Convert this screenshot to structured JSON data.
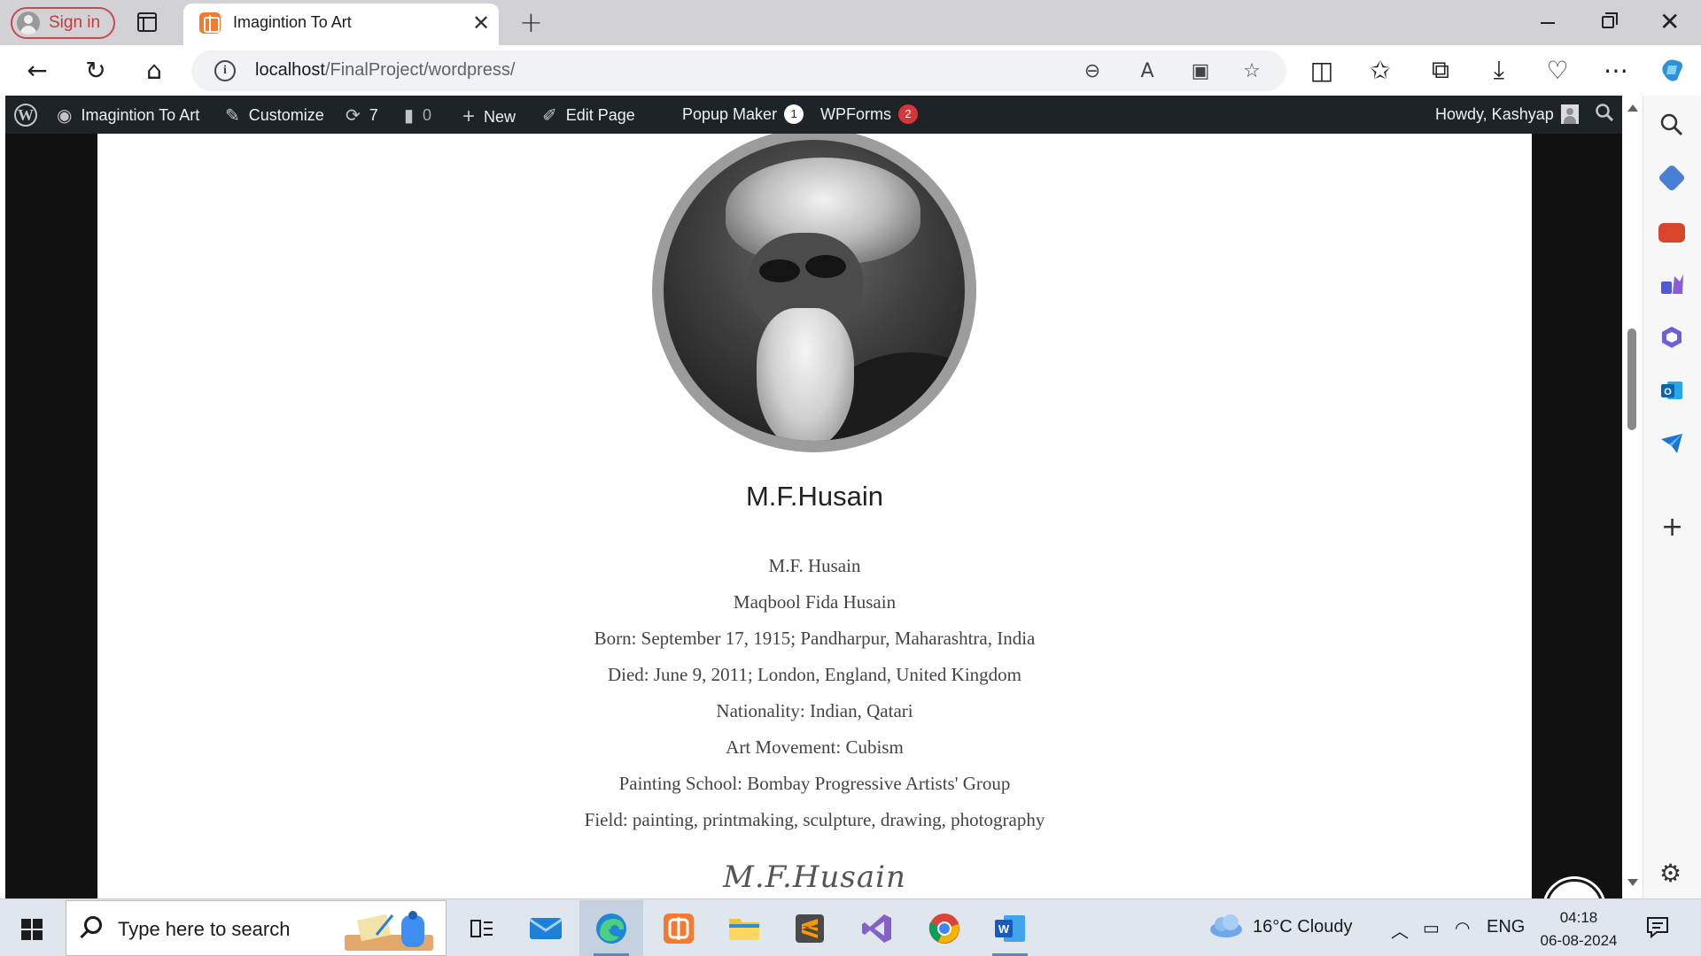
{
  "browser": {
    "signin_label": "Sign in",
    "tab_title": "Imagintion To Art",
    "url_host": "localhost",
    "url_path": "/FinalProject/wordpress/"
  },
  "wp_admin_bar": {
    "site_name": "Imagintion To Art",
    "customize": "Customize",
    "updates_count": "7",
    "comments_count": "0",
    "new_label": "New",
    "edit_page": "Edit Page",
    "popup_maker": "Popup Maker",
    "popup_maker_badge": "1",
    "wpforms": "WPForms",
    "wpforms_badge": "2",
    "howdy": "Howdy, Kashyap"
  },
  "artist": {
    "name": "M.F.Husain",
    "bio_lines": [
      "M.F. Husain",
      "Maqbool Fida Husain",
      "Born: September 17, 1915; Pandharpur, Maharashtra, India",
      "Died: June 9, 2011; London, England, United Kingdom",
      "Nationality: Indian, Qatari",
      "Art Movement: Cubism",
      "Painting School: Bombay Progressive Artists' Group",
      "Field: painting, printmaking, sculpture, drawing, photography"
    ],
    "signature": "M.F.Husain"
  },
  "taskbar": {
    "search_placeholder": "Type here to search",
    "weather": "16°C  Cloudy",
    "language": "ENG",
    "time": "04:18",
    "date": "06-08-2024"
  },
  "colors": {
    "wp_admin_bar": "#1d2327",
    "badge_red": "#d63638",
    "signin_red": "#c94b4b",
    "tab_favicon": "#f47a31"
  }
}
